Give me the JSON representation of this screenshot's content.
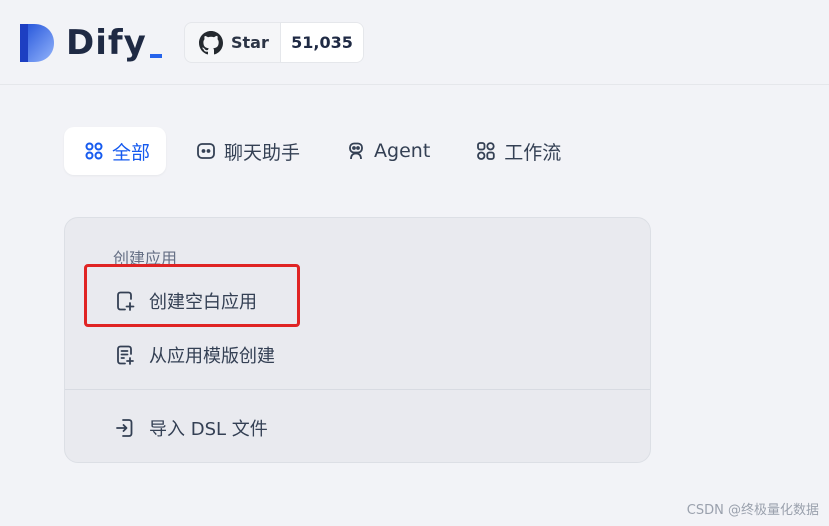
{
  "header": {
    "logo_text": "Dify",
    "github": {
      "label": "Star",
      "count": "51,035"
    }
  },
  "tabs": [
    {
      "label": "全部",
      "icon": "grid-icon",
      "active": true
    },
    {
      "label": "聊天助手",
      "icon": "chat-bot-icon",
      "active": false
    },
    {
      "label": "Agent",
      "icon": "robot-icon",
      "active": false
    },
    {
      "label": "工作流",
      "icon": "workflow-icon",
      "active": false
    }
  ],
  "create_card": {
    "title": "创建应用",
    "items": [
      {
        "label": "创建空白应用",
        "icon": "file-plus-icon"
      },
      {
        "label": "从应用模版创建",
        "icon": "template-icon"
      },
      {
        "label": "导入 DSL 文件",
        "icon": "import-icon"
      }
    ]
  },
  "watermark": "CSDN @终极量化数据",
  "colors": {
    "accent": "#155aef",
    "highlight": "#e02424",
    "background": "#f2f3f7"
  }
}
